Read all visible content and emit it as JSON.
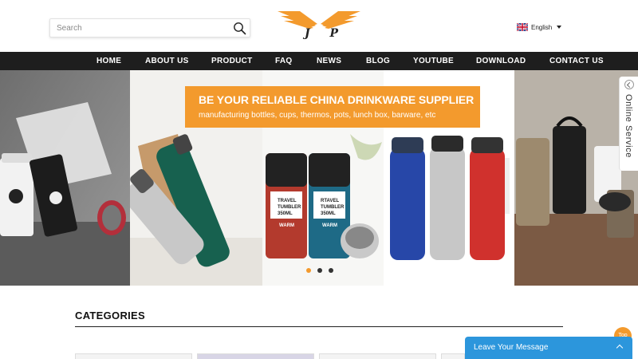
{
  "search": {
    "placeholder": "Search",
    "icon": "search-icon"
  },
  "logo": {
    "text": "J P",
    "accent": "#f39a2d"
  },
  "language": {
    "label": "English",
    "icon": "uk-flag-icon"
  },
  "nav": {
    "items": [
      {
        "label": "HOME"
      },
      {
        "label": "ABOUT US"
      },
      {
        "label": "PRODUCT"
      },
      {
        "label": "FAQ"
      },
      {
        "label": "NEWS"
      },
      {
        "label": "BLOG"
      },
      {
        "label": "YOUTUBE"
      },
      {
        "label": "DOWNLOAD"
      },
      {
        "label": "CONTACT US"
      }
    ]
  },
  "banner": {
    "title": "BE YOUR RELIABLE CHINA DRINKWARE SUPPLIER",
    "subtitle": "manufacturing bottles, cups, thermos, pots, lunch box, barware, etc",
    "tumbler_text_1": "TRAVEL\nTUMBLER\n350ML",
    "tumbler_text_2": "RTAVEL\nTUMBLER\n350ML",
    "warm_label": "WARM",
    "slides": 3,
    "active_slide": 1
  },
  "online_service": {
    "label": "Online Service"
  },
  "categories": {
    "title": "CATEGORIES"
  },
  "top_button": {
    "label": "Top"
  },
  "leave_message": {
    "label": "Leave Your Message"
  },
  "colors": {
    "accent": "#f39a2d",
    "nav_bg": "#1e1e1e",
    "chat_bg": "#2c96dc"
  }
}
